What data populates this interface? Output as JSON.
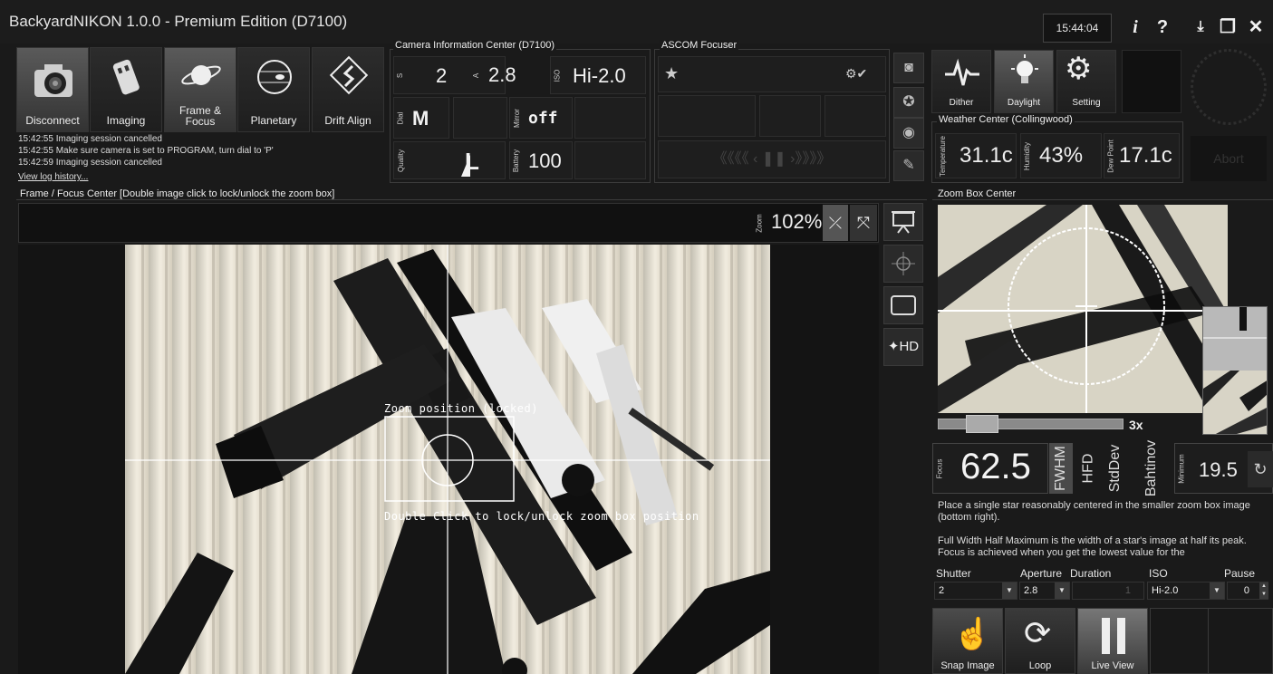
{
  "window": {
    "title": "BackyardNIKON 1.0.0 - Premium Edition (D7100)",
    "clock": "15:44:04"
  },
  "modes": [
    {
      "label": "Disconnect",
      "icon": "camera-icon"
    },
    {
      "label": "Imaging",
      "icon": "film-icon"
    },
    {
      "label": "Frame & Focus",
      "icon": "saturn-icon"
    },
    {
      "label": "Planetary",
      "icon": "jupiter-icon"
    },
    {
      "label": "Drift Align",
      "icon": "drift-icon"
    }
  ],
  "log": {
    "lines": [
      "15:42:55  Imaging session cancelled",
      "15:42:55  Make sure camera is set to PROGRAM, turn dial to 'P'",
      "15:42:59  Imaging session cancelled"
    ],
    "history_link": "View log history..."
  },
  "camera_info": {
    "title": "Camera Information Center (D7100)",
    "s_label": "S",
    "s_value": "2",
    "a_label": "A",
    "a_value": "2.8",
    "iso_label": "ISO",
    "iso_value": "Hi-2.0",
    "dial_label": "Dial",
    "dial_value": "M",
    "mirror_label": "Mirror",
    "mirror_value": "off",
    "quality_label": "Quality",
    "quality_value": "L",
    "battery_label": "Battery",
    "battery_value": "100"
  },
  "focuser": {
    "title": "ASCOM Focuser",
    "nav": "《《《《 ‹  ❚❚  ›》》》》"
  },
  "weather_buttons": [
    {
      "label": "Dither",
      "icon": "pulse-icon"
    },
    {
      "label": "Daylight",
      "icon": "lightbulb-icon"
    },
    {
      "label": "Setting",
      "icon": "gears-icon"
    }
  ],
  "weather": {
    "title": "Weather Center (Collingwood)",
    "temp_label": "Temperature",
    "temp_value": "31.1c",
    "humidity_label": "Humidity",
    "humidity_value": "43%",
    "dew_label": "Dew Point",
    "dew_value": "17.1c"
  },
  "abort_label": "Abort",
  "frame_focus": {
    "title": "Frame / Focus Center  [Double image click to lock/unlock the zoom box]",
    "zoom_label": "Zoom",
    "zoom_value": "102%",
    "overlay_top": "Zoom position  (locked)",
    "overlay_bottom": "Double Click to lock/unlock zoom box position"
  },
  "zoom_box": {
    "title": "Zoom Box Center",
    "magnification": "3x",
    "magnification_level": 0.18,
    "focus_label": "Focus",
    "focus_value": "62.5",
    "metrics": [
      "FWHM",
      "HFD",
      "StdDev",
      "Bahtinov"
    ],
    "minimum_label": "Minimum",
    "minimum_value": "19.5",
    "help1": "Place a single star reasonably centered in the smaller zoom box image (bottom right).",
    "help2": "Full Width Half Maximum is the width of a star's image at half its peak. Focus is achieved when you get the lowest value for the"
  },
  "controls": {
    "shutter_label": "Shutter",
    "shutter_value": "2",
    "aperture_label": "Aperture",
    "aperture_value": "2.8",
    "duration_label": "Duration",
    "duration_value": "1",
    "iso_label": "ISO",
    "iso_value": "Hi-2.0",
    "pause_label": "Pause",
    "pause_value": "0"
  },
  "actions": [
    {
      "label": "Snap Image",
      "icon": "hand-icon"
    },
    {
      "label": "Loop",
      "icon": "loop-icon"
    },
    {
      "label": "Live View",
      "icon": "pause-bars-icon"
    }
  ]
}
